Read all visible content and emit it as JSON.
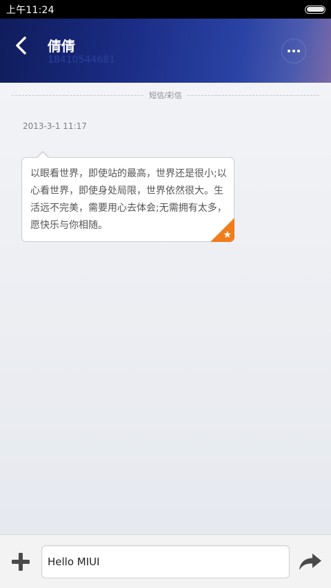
{
  "status_bar": {
    "time": "上午11:24",
    "battery_level": 1.0
  },
  "header": {
    "contact_name": "倩倩",
    "phone_number": "18410544681",
    "back_icon": "chevron-left-icon",
    "more_icon": "more-horizontal-icon"
  },
  "conversation": {
    "divider_label": "短信/彩信",
    "messages": [
      {
        "timestamp": "2013-3-1 11:17",
        "text": "以眼看世界，即使站的最高，世界还是很小;以心看世界，即使身处局限，世界依然很大。生活远不完美，需要用心去体会;无需拥有太多，愿快乐与你相随。",
        "starred": true
      }
    ]
  },
  "composer": {
    "input_value": "Hello MIUI",
    "add_icon": "plus-icon",
    "send_icon": "share-arrow-icon"
  },
  "colors": {
    "header_start": "#101c5c",
    "header_end": "#7b6aa8",
    "star_badge": "#f07c1c",
    "phone_number": "#2a3f9a"
  }
}
